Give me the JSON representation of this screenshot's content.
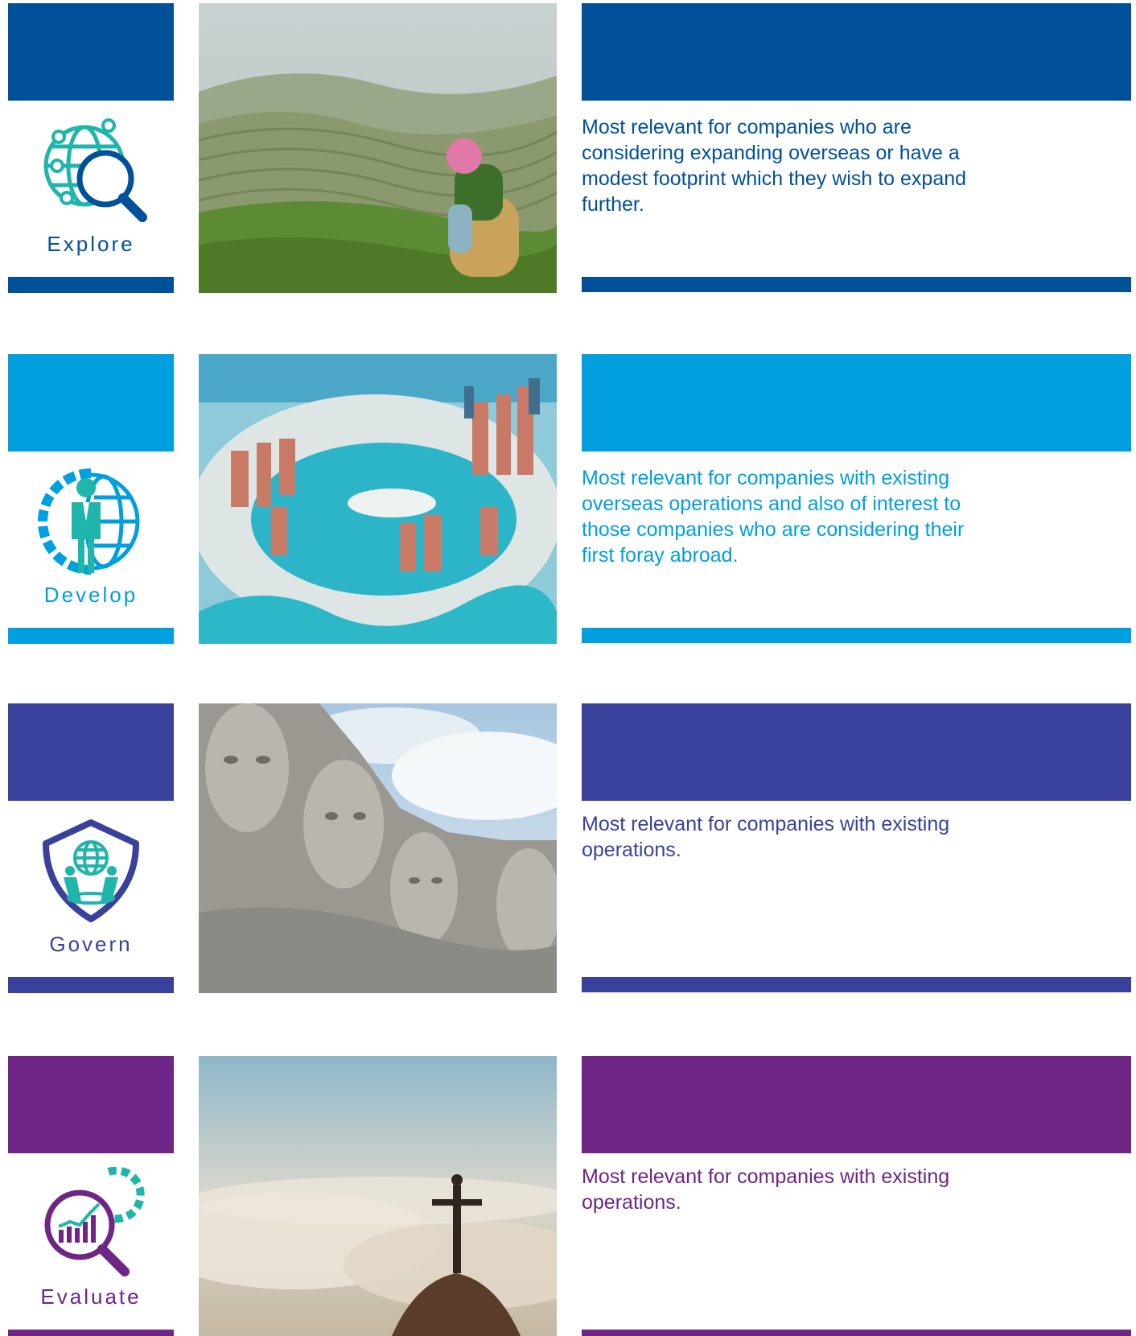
{
  "colors": {
    "explore": "#00509a",
    "develop": "#009fdf",
    "govern": "#3a419c",
    "evaluate": "#6e2585",
    "teal": "#1fb5aa"
  },
  "phases": [
    {
      "label": "Explore",
      "icon": "globe-search-icon",
      "photo": "rice-terraces-tea-picker-photo",
      "description": "Most relevant for companies who are considering expanding overseas or have a modest footprint which they wish to expand further."
    },
    {
      "label": "Develop",
      "icon": "gear-globe-person-icon",
      "photo": "pearl-island-aerial-photo",
      "description": "Most relevant for companies with existing overseas operations and also of interest to those companies who are considering their first foray abroad."
    },
    {
      "label": "Govern",
      "icon": "shield-globe-icon",
      "photo": "mount-rushmore-photo",
      "description": "Most relevant for companies with existing operations."
    },
    {
      "label": "Evaluate",
      "icon": "chart-magnifier-gear-icon",
      "photo": "christ-the-redeemer-clouds-photo",
      "description": "Most relevant for companies with existing operations."
    }
  ]
}
